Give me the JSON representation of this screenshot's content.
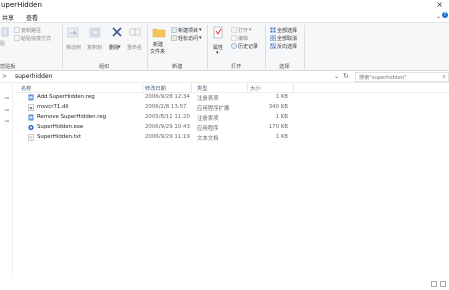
{
  "window": {
    "title": "uperHidden",
    "close_glyph": "×"
  },
  "tabs": {
    "share": "共享",
    "view": "查看"
  },
  "ribbon": {
    "clipboard": {
      "pin": "贴",
      "copy_path": "复制路径",
      "paste_shortcut": "粘贴快捷方式",
      "clip": "剪贴板"
    },
    "organize": {
      "move_to": "移动到",
      "copy_to": "复制到",
      "delete": "删除",
      "rename": "重命名",
      "group": "组织"
    },
    "new": {
      "new_folder_line1": "新建",
      "new_folder_line2": "文件夹",
      "new_item": "新建项目",
      "easy_access": "轻松访问",
      "group": "新建"
    },
    "open": {
      "properties": "属性",
      "open": "打开",
      "edit": "编辑",
      "history": "历史记录",
      "group": "打开"
    },
    "select": {
      "select_all": "全部选择",
      "select_none": "全部取消",
      "invert": "反向选择",
      "group": "选择"
    }
  },
  "address": {
    "path": "superhidden",
    "sep": ">"
  },
  "search": {
    "placeholder": "搜索\"superhidden\""
  },
  "columns": {
    "name": "名称",
    "modified": "修改日期",
    "type": "类型",
    "size": "大小"
  },
  "files": [
    {
      "name": "Add SuperHidden.reg",
      "modified": "2006/9/28 12:34",
      "type": "注册表项",
      "size": "1 KB",
      "icon": "reg-file-icon"
    },
    {
      "name": "msvcr71.dll",
      "modified": "2006/2/8 13:57",
      "type": "应用程序扩展",
      "size": "340 KB",
      "icon": "dll-file-icon"
    },
    {
      "name": "Remove SuperHidden.reg",
      "modified": "2005/8/11 11:20",
      "type": "注册表项",
      "size": "1 KB",
      "icon": "reg-file-icon"
    },
    {
      "name": "SuperHidden.exe",
      "modified": "2006/9/29 10:43",
      "type": "应用程序",
      "size": "170 KB",
      "icon": "exe-file-icon"
    },
    {
      "name": "SuperHidden.txt",
      "modified": "2006/9/29 11:19",
      "type": "文本文档",
      "size": "1 KB",
      "icon": "txt-file-icon"
    }
  ],
  "colors": {
    "accent": "#1f6fd1",
    "header_text": "#4c607a",
    "ribbon_bg": "#f6f7f9"
  }
}
